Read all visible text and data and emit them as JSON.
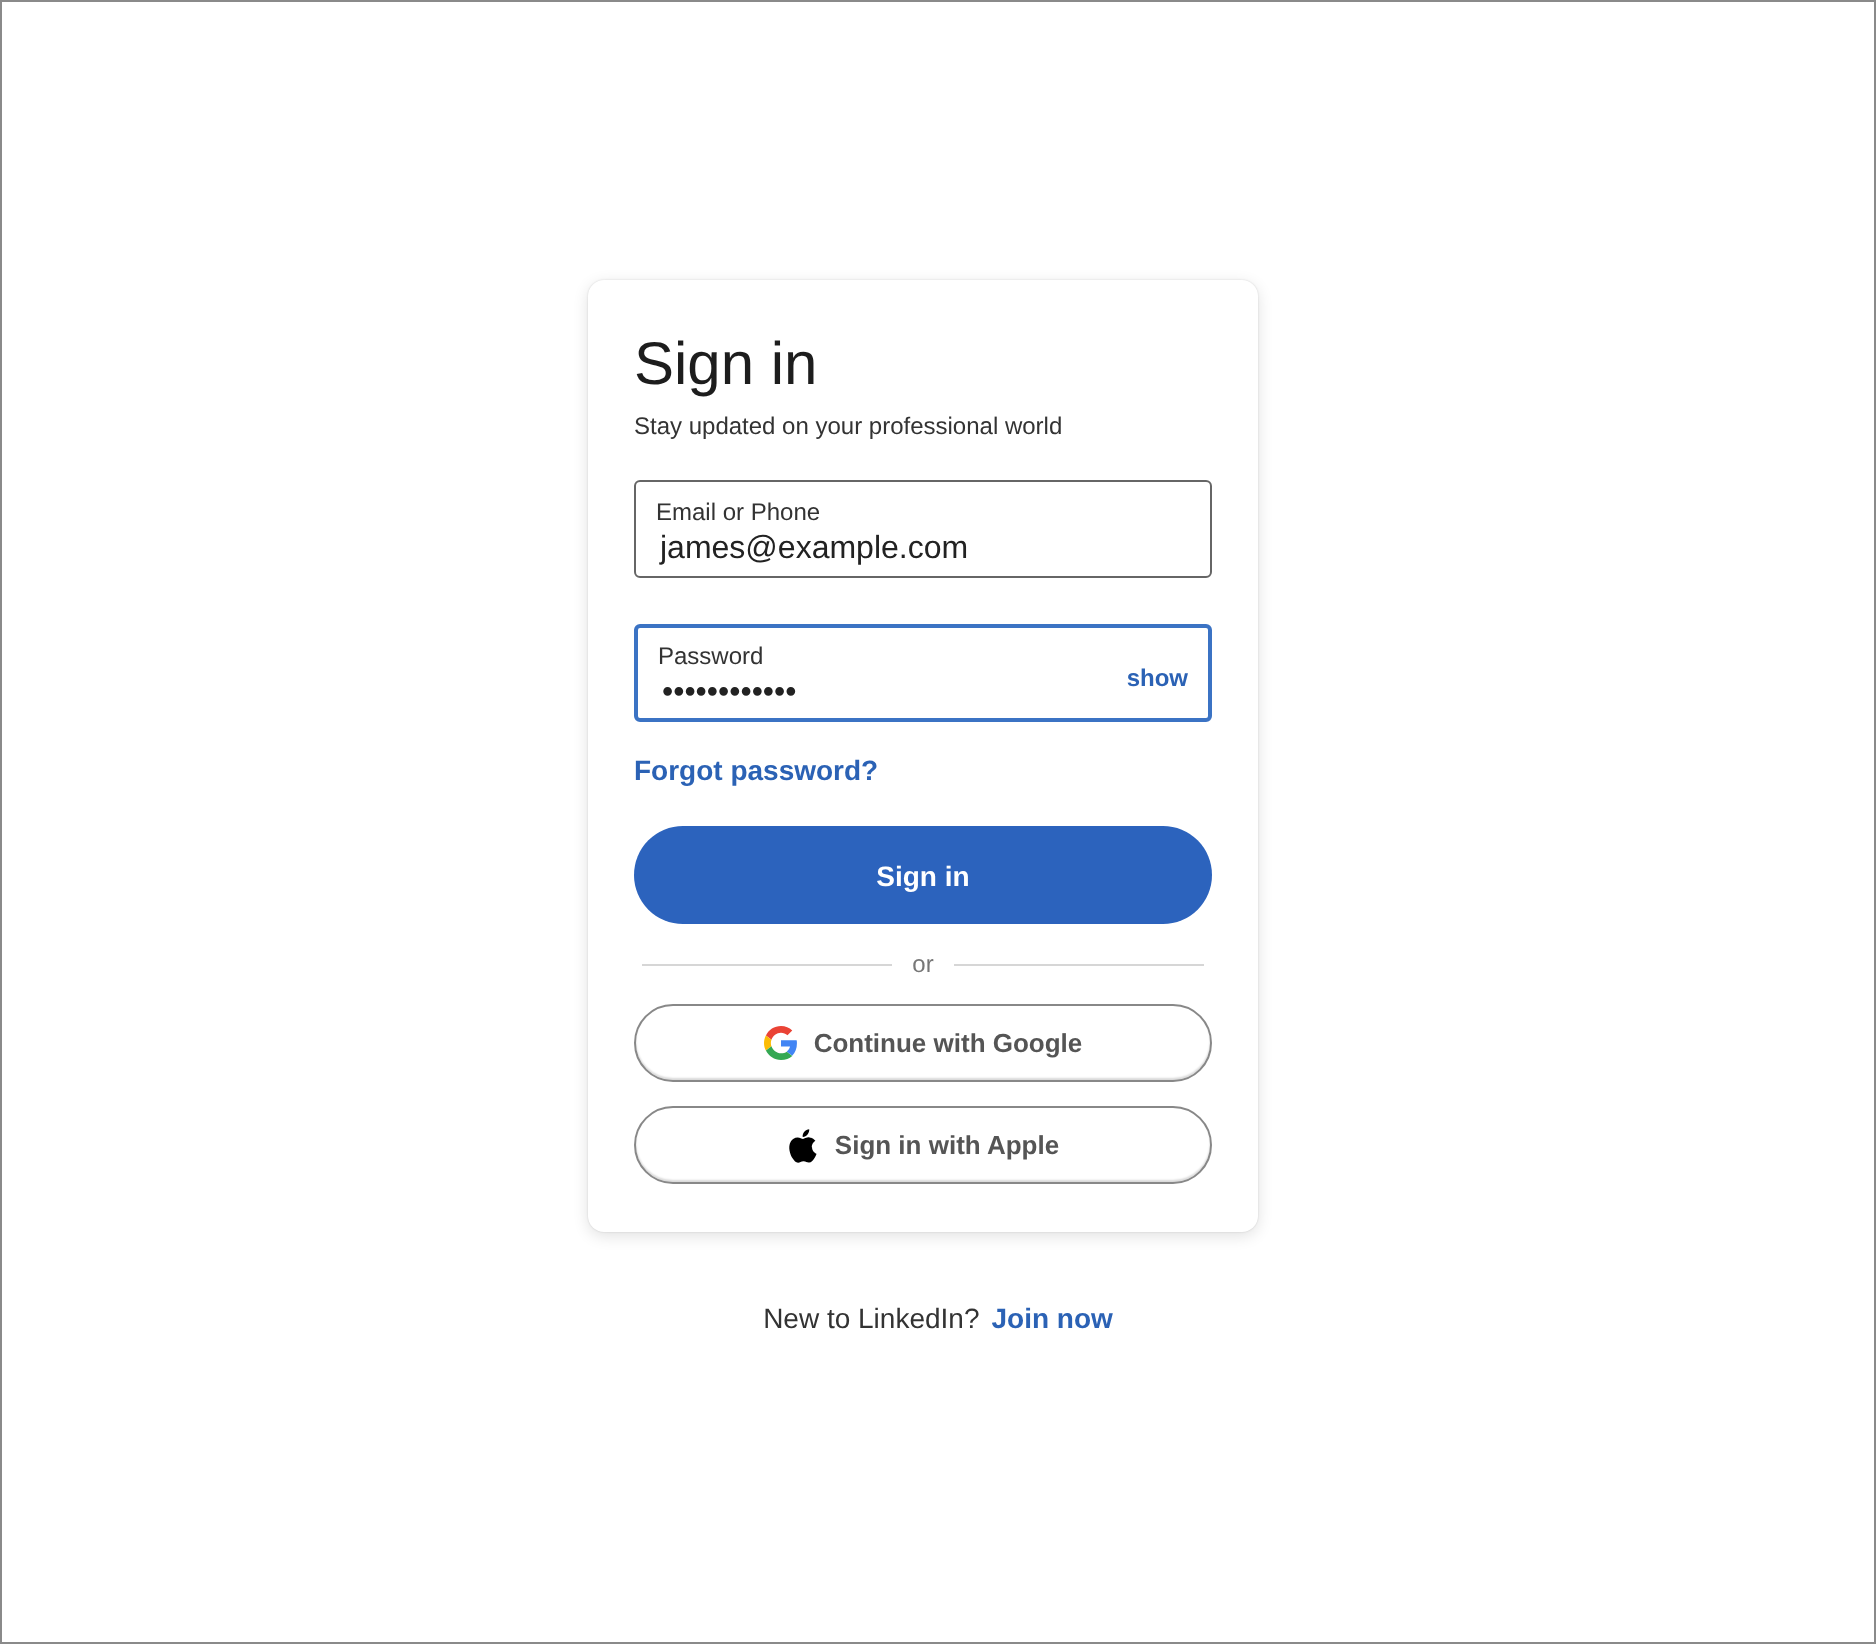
{
  "card": {
    "title": "Sign in",
    "subtitle": "Stay updated on your professional world",
    "fields": [
      {
        "label": "Email or Phone",
        "value": "james@example.com",
        "focused": false
      },
      {
        "label": "Password",
        "value": "••••••••••••",
        "focused": true,
        "toggle": "show"
      }
    ],
    "forgot_link": "Forgot password?",
    "submit_button": "Sign in",
    "divider": "or",
    "social_buttons": [
      {
        "kind": "google",
        "label": "Continue with Google"
      },
      {
        "kind": "apple",
        "label": "Sign in with Apple"
      }
    ]
  },
  "footer": {
    "text": "New to LinkedIn?",
    "link": "Join now"
  }
}
